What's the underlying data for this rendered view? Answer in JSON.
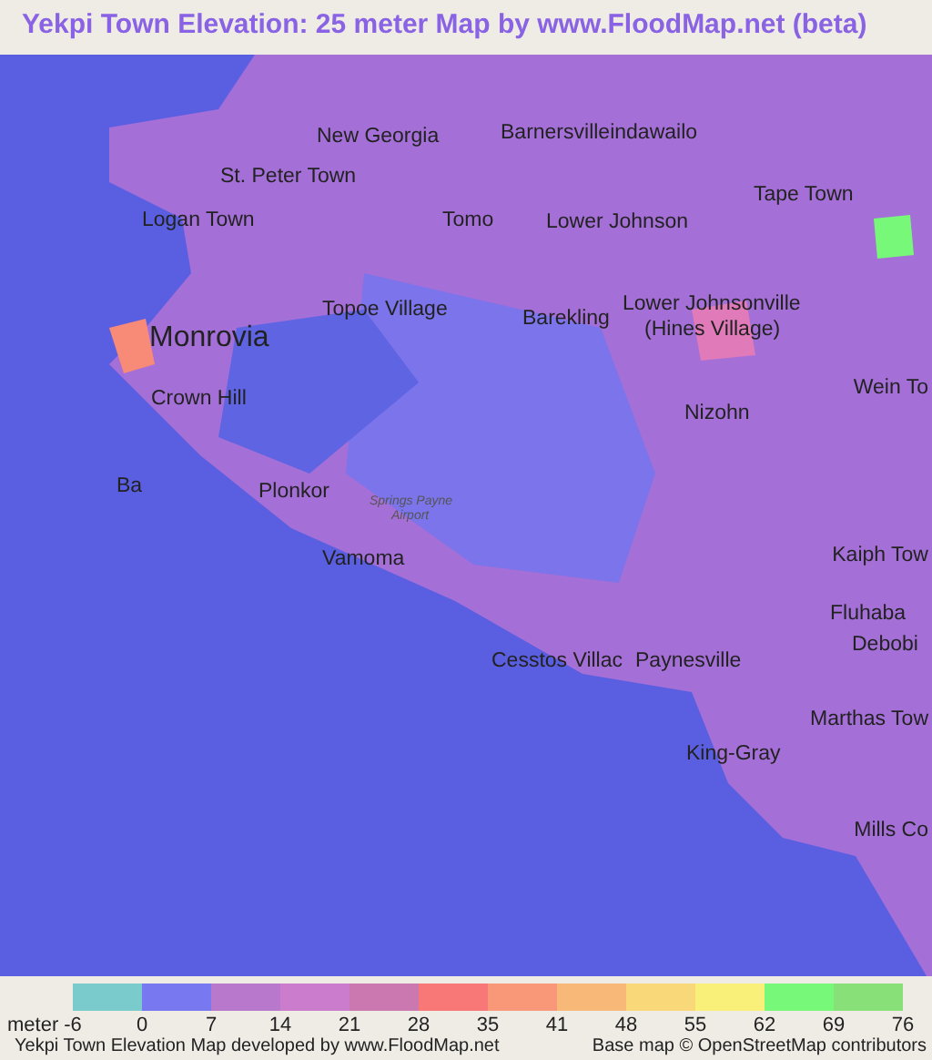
{
  "title": "Yekpi Town Elevation: 25 meter Map by www.FloodMap.net (beta)",
  "map": {
    "places": [
      {
        "name": "New Georgia"
      },
      {
        "name": "Barnersvilleindawailo"
      },
      {
        "name": "St. Peter Town"
      },
      {
        "name": "Tape Town"
      },
      {
        "name": "Logan Town"
      },
      {
        "name": "Tomo"
      },
      {
        "name": "Lower Johnson"
      },
      {
        "name": "Topoe Village"
      },
      {
        "name": "Monrovia"
      },
      {
        "name": "Barekling"
      },
      {
        "name": "Lower Johnsonville"
      },
      {
        "name": "(Hines Village)"
      },
      {
        "name": "Crown Hill"
      },
      {
        "name": "Wein To"
      },
      {
        "name": "Nizohn"
      },
      {
        "name": "Ba"
      },
      {
        "name": "Plonkor"
      },
      {
        "name": "Springs Payne"
      },
      {
        "name": "Airport"
      },
      {
        "name": "Kaiph Tow"
      },
      {
        "name": "Vamoma"
      },
      {
        "name": "Fluhaba"
      },
      {
        "name": "Cesstos Villac"
      },
      {
        "name": "Paynesville"
      },
      {
        "name": "Debobi"
      },
      {
        "name": "Marthas Tow"
      },
      {
        "name": "King-Gray"
      },
      {
        "name": "Mills Co"
      }
    ]
  },
  "legend": {
    "unit": "meter",
    "first_tick": "-6",
    "items": [
      {
        "color": "#7acccc",
        "label": "0"
      },
      {
        "color": "#7878f0",
        "label": "7"
      },
      {
        "color": "#b878cc",
        "label": "14"
      },
      {
        "color": "#cc7ccc",
        "label": "21"
      },
      {
        "color": "#cc78b0",
        "label": "28"
      },
      {
        "color": "#f87878",
        "label": "35"
      },
      {
        "color": "#f89878",
        "label": "41"
      },
      {
        "color": "#f8b878",
        "label": "48"
      },
      {
        "color": "#f8d878",
        "label": "55"
      },
      {
        "color": "#f8f078",
        "label": "62"
      },
      {
        "color": "#78f878",
        "label": "69"
      },
      {
        "color": "#88e078",
        "label": "76"
      }
    ]
  },
  "footer": {
    "left": "Yekpi Town Elevation Map developed by www.FloodMap.net",
    "right": "Base map © OpenStreetMap contributors"
  }
}
